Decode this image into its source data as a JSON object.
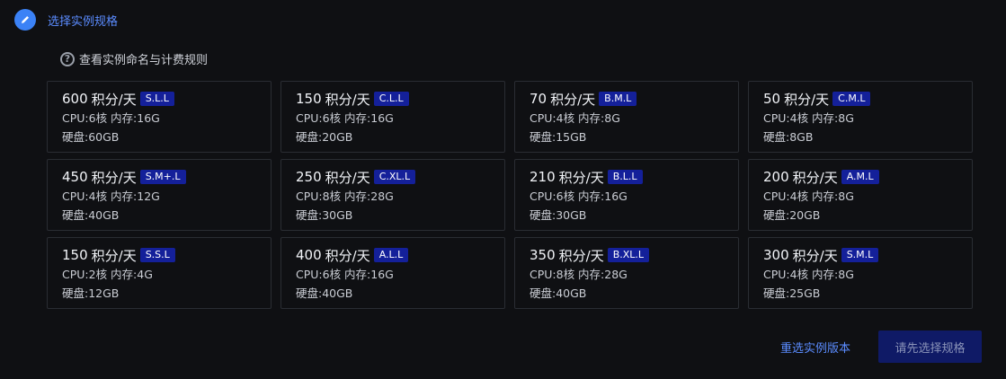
{
  "header": {
    "title": "选择实例规格",
    "icon": "pencil-icon"
  },
  "help": {
    "text": "查看实例命名与计费规则",
    "icon": "question-icon"
  },
  "cards": [
    {
      "price": "600",
      "unit": "积分/天",
      "code": "S.L.L",
      "cpu_mem": "CPU:6核 内存:16G",
      "disk": "硬盘:60GB"
    },
    {
      "price": "150",
      "unit": "积分/天",
      "code": "C.L.L",
      "cpu_mem": "CPU:6核 内存:16G",
      "disk": "硬盘:20GB"
    },
    {
      "price": "70",
      "unit": "积分/天",
      "code": "B.M.L",
      "cpu_mem": "CPU:4核 内存:8G",
      "disk": "硬盘:15GB"
    },
    {
      "price": "50",
      "unit": "积分/天",
      "code": "C.M.L",
      "cpu_mem": "CPU:4核 内存:8G",
      "disk": "硬盘:8GB"
    },
    {
      "price": "450",
      "unit": "积分/天",
      "code": "S.M+.L",
      "cpu_mem": "CPU:4核 内存:12G",
      "disk": "硬盘:40GB"
    },
    {
      "price": "250",
      "unit": "积分/天",
      "code": "C.XL.L",
      "cpu_mem": "CPU:8核 内存:28G",
      "disk": "硬盘:30GB"
    },
    {
      "price": "210",
      "unit": "积分/天",
      "code": "B.L.L",
      "cpu_mem": "CPU:6核 内存:16G",
      "disk": "硬盘:30GB"
    },
    {
      "price": "200",
      "unit": "积分/天",
      "code": "A.M.L",
      "cpu_mem": "CPU:4核 内存:8G",
      "disk": "硬盘:20GB"
    },
    {
      "price": "150",
      "unit": "积分/天",
      "code": "S.S.L",
      "cpu_mem": "CPU:2核 内存:4G",
      "disk": "硬盘:12GB"
    },
    {
      "price": "400",
      "unit": "积分/天",
      "code": "A.L.L",
      "cpu_mem": "CPU:6核 内存:16G",
      "disk": "硬盘:40GB"
    },
    {
      "price": "350",
      "unit": "积分/天",
      "code": "B.XL.L",
      "cpu_mem": "CPU:8核 内存:28G",
      "disk": "硬盘:40GB"
    },
    {
      "price": "300",
      "unit": "积分/天",
      "code": "S.M.L",
      "cpu_mem": "CPU:4核 内存:8G",
      "disk": "硬盘:25GB"
    }
  ],
  "footer": {
    "reset_label": "重选实例版本",
    "submit_label": "请先选择规格"
  },
  "colors": {
    "accent": "#5b8cff",
    "badge_bg": "#14209a",
    "button_bg": "#0f1a66"
  }
}
